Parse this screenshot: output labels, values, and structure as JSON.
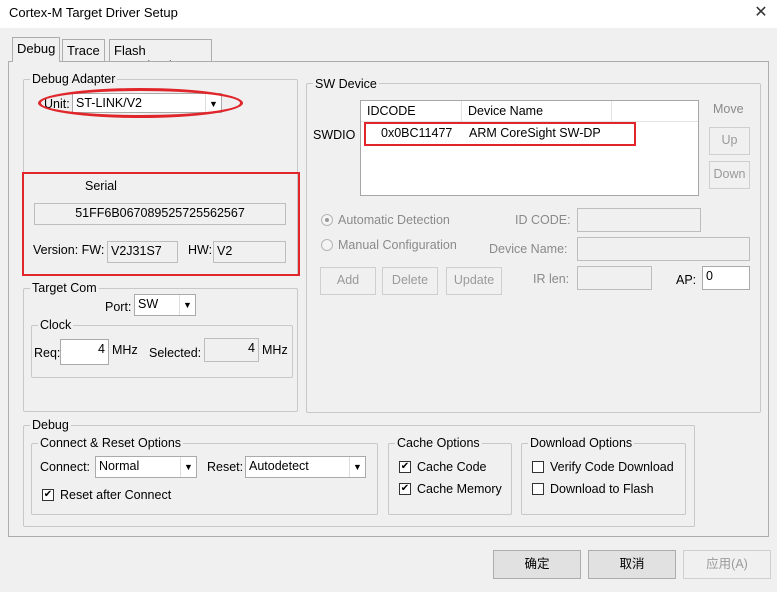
{
  "window": {
    "title": "Cortex-M Target Driver Setup",
    "close_glyph": "✕"
  },
  "tabs": [
    {
      "label": "Debug"
    },
    {
      "label": "Trace"
    },
    {
      "label": "Flash Download"
    }
  ],
  "debug_adapter": {
    "legend": "Debug Adapter",
    "unit_label": "Unit:",
    "unit_value": "ST-LINK/V2",
    "serial_label": "Serial",
    "serial_value": "51FF6B067089525725562567",
    "version_label": "Version: FW:",
    "fw_value": "V2J31S7",
    "hw_label": "HW:",
    "hw_value": "V2"
  },
  "target_com": {
    "legend": "Target Com",
    "port_label": "Port:",
    "port_value": "SW",
    "clock_legend": "Clock",
    "req_label": "Req:",
    "req_value": "4",
    "req_unit": "MHz",
    "selected_label": "Selected:",
    "selected_value": "4",
    "selected_unit": "MHz"
  },
  "sw_device": {
    "legend": "SW Device",
    "swdio_label": "SWDIO",
    "col_idcode": "IDCODE",
    "col_device_name": "Device Name",
    "row": {
      "idcode": "0x0BC11477",
      "device_name": "ARM CoreSight SW-DP"
    },
    "move_label": "Move",
    "up_label": "Up",
    "down_label": "Down",
    "auto_detect_label": "Automatic Detection",
    "manual_config_label": "Manual Configuration",
    "id_code_label": "ID CODE:",
    "device_name_label": "Device Name:",
    "ir_len_label": "IR len:",
    "ap_label": "AP:",
    "ap_value": "0",
    "add_label": "Add",
    "delete_label": "Delete",
    "update_label": "Update"
  },
  "debug": {
    "legend": "Debug",
    "connect_reset_legend": "Connect & Reset Options",
    "connect_label": "Connect:",
    "connect_value": "Normal",
    "reset_label": "Reset:",
    "reset_value": "Autodetect",
    "reset_after_connect_label": "Reset after Connect",
    "reset_after_connect_checked": true,
    "cache_legend": "Cache Options",
    "cache_code_label": "Cache Code",
    "cache_code_checked": true,
    "cache_memory_label": "Cache Memory",
    "cache_memory_checked": true,
    "download_legend": "Download Options",
    "verify_label": "Verify Code Download",
    "verify_checked": false,
    "download_flash_label": "Download to Flash",
    "download_flash_checked": false
  },
  "footer": {
    "ok_label": "确定",
    "cancel_label": "取消",
    "apply_label": "应用(A)"
  },
  "colors": {
    "highlight_red": "#e0262a",
    "background": "#f0f0f0"
  },
  "icons": {
    "dropdown": "chevron-down-icon",
    "check": "check-icon",
    "close": "close-icon"
  }
}
